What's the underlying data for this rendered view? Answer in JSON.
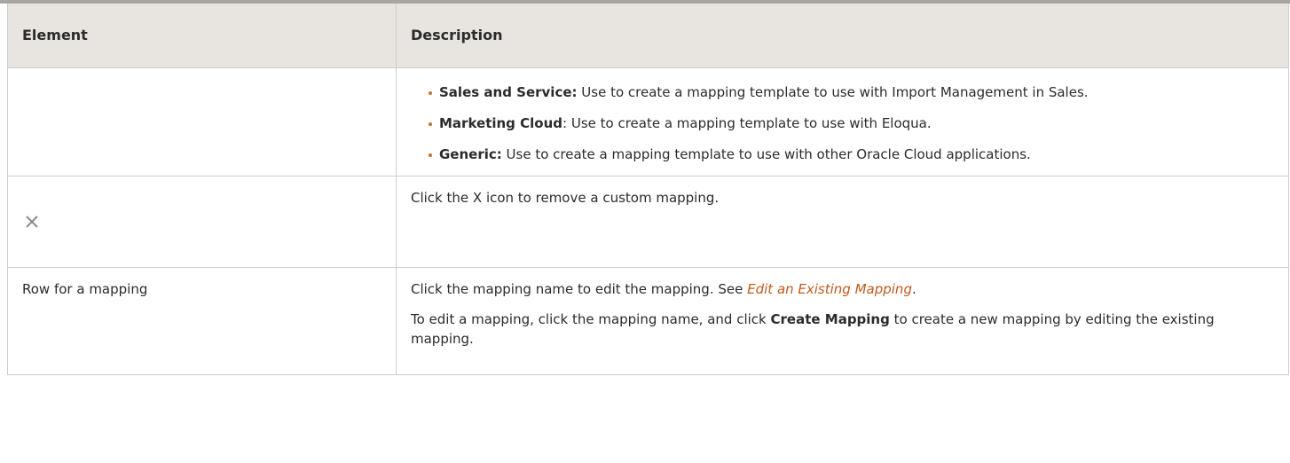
{
  "headers": {
    "element": "Element",
    "description": "Description"
  },
  "row1": {
    "items": [
      {
        "bold": "Sales and Service:",
        "text": " Use to create a mapping template to use with Import Management in Sales."
      },
      {
        "bold": "Marketing Cloud",
        "text": ": Use to create a mapping template to use with Eloqua."
      },
      {
        "bold": "Generic:",
        "text": " Use to create a mapping template to use with other Oracle Cloud applications."
      }
    ]
  },
  "row2": {
    "icon": "close-icon",
    "description": "Click the X icon to remove a custom mapping."
  },
  "row3": {
    "element": "Row for a mapping",
    "desc1_text": "Click the mapping name to edit the mapping. See ",
    "desc1_link": "Edit an Existing Mapping",
    "desc1_end": ".",
    "desc2_pre": "To edit a mapping, click the mapping name, and click ",
    "desc2_bold": "Create Mapping",
    "desc2_post": " to create a new mapping by editing the existing mapping."
  },
  "colors": {
    "link": "#c05a1c",
    "bullet": "#c86e35",
    "header_bg": "#e8e5e0",
    "icon": "#8a8a8a"
  }
}
